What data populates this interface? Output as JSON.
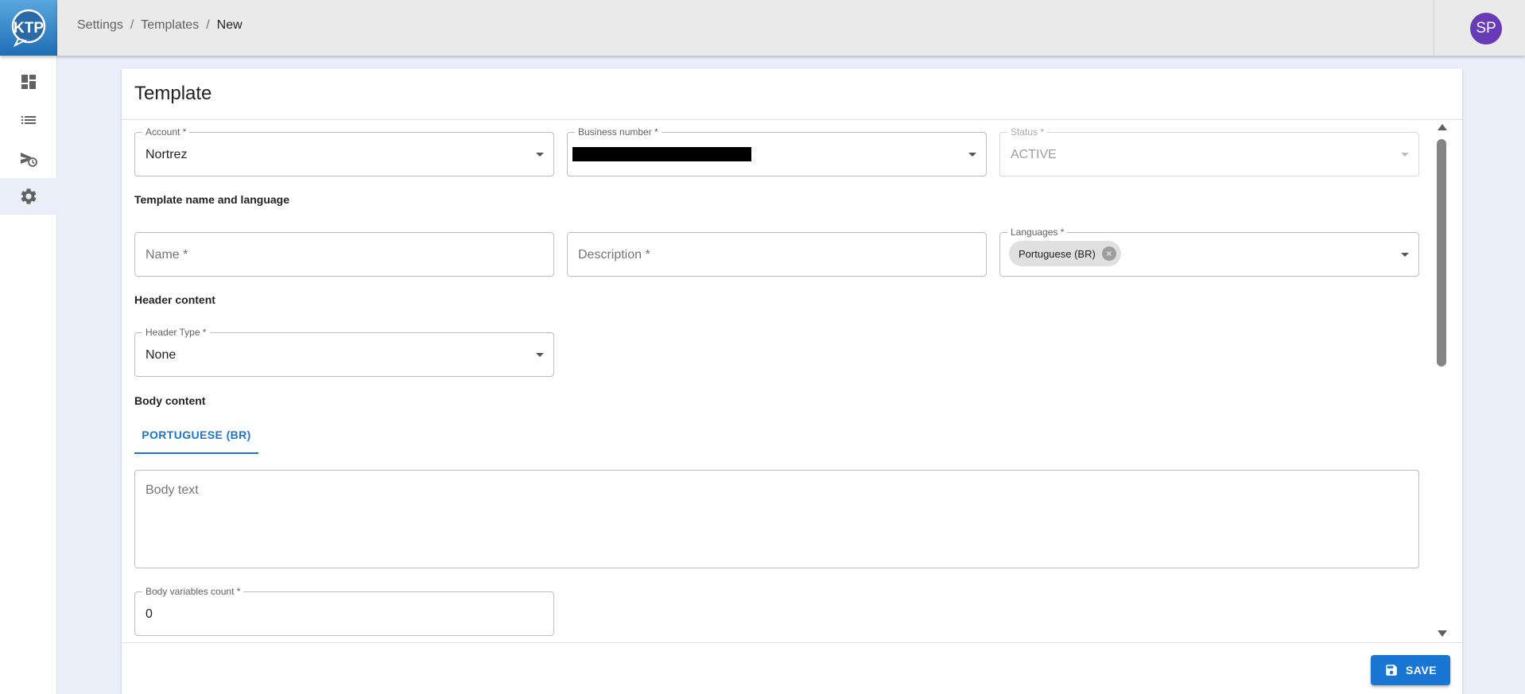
{
  "logo": {
    "text": "KTP"
  },
  "sidebar": {
    "items": [
      {
        "icon": "dashboard-icon"
      },
      {
        "icon": "list-icon"
      },
      {
        "icon": "scheduled-send-icon"
      },
      {
        "icon": "settings-gear-icon",
        "active": true
      }
    ]
  },
  "breadcrumb": [
    "Settings",
    "Templates",
    "New"
  ],
  "breadcrumb_separator": "/",
  "user": {
    "initials": "SP",
    "avatar_color": "#673ab7"
  },
  "card": {
    "title": "Template"
  },
  "fields": {
    "account": {
      "label": "Account *",
      "value": "Nortrez"
    },
    "business_number": {
      "label": "Business number *",
      "value": ""
    },
    "status": {
      "label": "Status *",
      "value": "ACTIVE"
    },
    "name": {
      "placeholder": "Name *"
    },
    "description": {
      "placeholder": "Description *"
    },
    "languages": {
      "label": "Languages *",
      "chip": "Portuguese (BR)"
    },
    "header_type": {
      "label": "Header Type *",
      "value": "None"
    },
    "body_text": {
      "placeholder": "Body text"
    },
    "body_variables_count": {
      "label": "Body variables count *",
      "value": "0"
    }
  },
  "sections": {
    "template_name_language": "Template name and language",
    "header_content": "Header content",
    "body_content": "Body content"
  },
  "tabs": [
    {
      "label": "PORTUGUESE (BR)",
      "active": true
    }
  ],
  "actions": {
    "save_label": "SAVE"
  },
  "colors": {
    "primary": "#1976d2",
    "background": "#eaeef8",
    "appbar": "#eaeaea"
  }
}
